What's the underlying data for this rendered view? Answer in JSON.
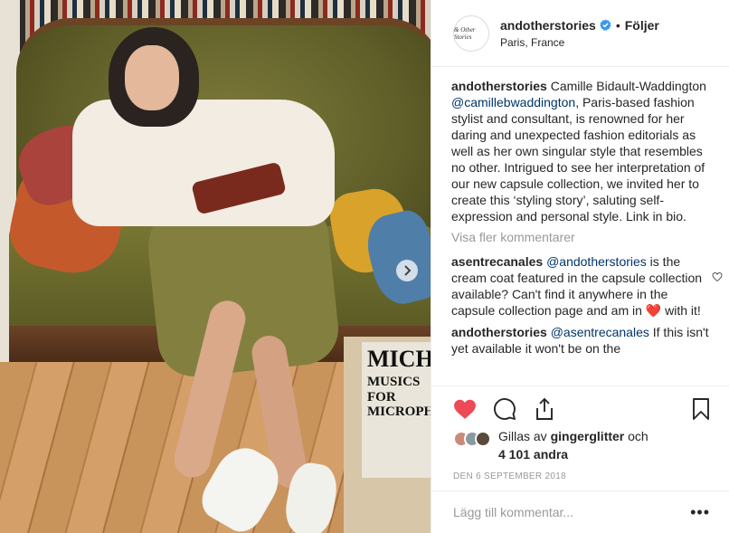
{
  "post": {
    "username": "andotherstories",
    "avatar_text": "& Other Stories",
    "follow_label": "Följer",
    "location": "Paris, France",
    "separator": "•"
  },
  "image": {
    "book_title": "MICHA",
    "book_subtitle": "MUSICS FOR\nMICROPHONE"
  },
  "comments": [
    {
      "user": "andotherstories",
      "text_before": "Camille Bidault-Waddington",
      "mention": "@camillebwaddington",
      "text_after": ", Paris-based fashion stylist and consultant, is renowned for her daring and unexpected fashion editorials as well as her own singular style that resembles no other. Intrigued to see her interpretation of our new capsule collection, we invited her to create this ‘styling story’, saluting self-expression and personal style. Link in bio."
    },
    {
      "user": "asentrecanales",
      "mention": "@andotherstories",
      "text_after": " is the cream coat featured in the capsule collection available? Can't find it anywhere in the capsule collection page and am in ",
      "emoji": "❤️",
      "text_end": " with it!"
    },
    {
      "user": "andotherstories",
      "mention": "@asentrecanales",
      "text_after": " If this isn't yet available it won't be on the"
    }
  ],
  "more_comments_label": "Visa fler kommentarer",
  "likes": {
    "prefix": "Gillas av ",
    "user": "gingerglitter",
    "middle": " och",
    "count": "4 101 andra"
  },
  "date": "DEN 6 SEPTEMBER 2018",
  "add_comment_placeholder": "Lägg till kommentar...",
  "more_options": "•••",
  "colors": {
    "like_red": "#ed4956",
    "verified_blue": "#3897f0",
    "mention": "#003569",
    "muted": "#999999"
  }
}
